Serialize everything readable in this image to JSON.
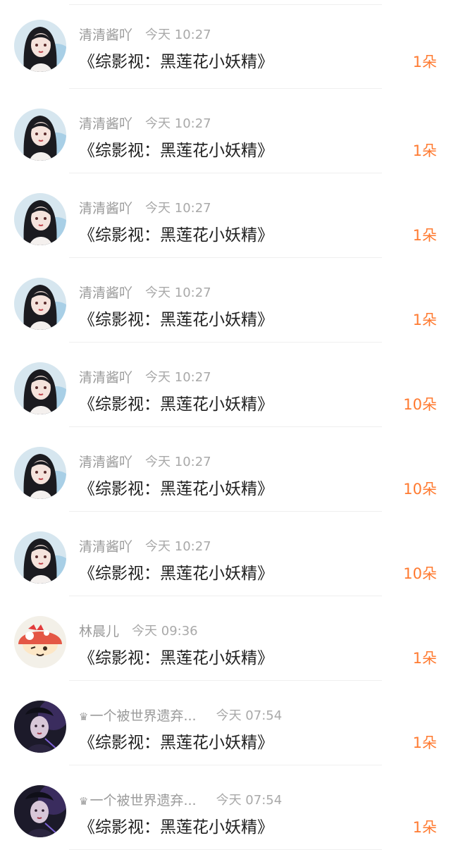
{
  "list": {
    "items": [
      {
        "name": "清清酱吖",
        "time": "今天 10:27",
        "title": "《综影视：黑莲花小妖精》",
        "count": "1朵",
        "avatar": "girl-dark-hair"
      },
      {
        "name": "清清酱吖",
        "time": "今天 10:27",
        "title": "《综影视：黑莲花小妖精》",
        "count": "1朵",
        "avatar": "girl-dark-hair"
      },
      {
        "name": "清清酱吖",
        "time": "今天 10:27",
        "title": "《综影视：黑莲花小妖精》",
        "count": "1朵",
        "avatar": "girl-dark-hair"
      },
      {
        "name": "清清酱吖",
        "time": "今天 10:27",
        "title": "《综影视：黑莲花小妖精》",
        "count": "1朵",
        "avatar": "girl-dark-hair"
      },
      {
        "name": "清清酱吖",
        "time": "今天 10:27",
        "title": "《综影视：黑莲花小妖精》",
        "count": "10朵",
        "avatar": "girl-dark-hair"
      },
      {
        "name": "清清酱吖",
        "time": "今天 10:27",
        "title": "《综影视：黑莲花小妖精》",
        "count": "10朵",
        "avatar": "girl-dark-hair"
      },
      {
        "name": "清清酱吖",
        "time": "今天 10:27",
        "title": "《综影视：黑莲花小妖精》",
        "count": "10朵",
        "avatar": "girl-dark-hair"
      },
      {
        "name": "林晨儿",
        "time": "今天 09:36",
        "title": "《综影视：黑莲花小妖精》",
        "count": "1朵",
        "avatar": "cartoon-mushroom"
      },
      {
        "name": "一个被世界遗弃...",
        "time": "今天 07:54",
        "title": "《综影视：黑莲花小妖精》",
        "count": "1朵",
        "avatar": "dark-portrait",
        "crown": "♛"
      },
      {
        "name": "一个被世界遗弃...",
        "time": "今天 07:54",
        "title": "《综影视：黑莲花小妖精》",
        "count": "1朵",
        "avatar": "dark-portrait",
        "crown": "♛"
      }
    ]
  },
  "colors": {
    "accent": "#ff7a30",
    "meta": "#9a9a9a",
    "title": "#1f1f1f"
  }
}
